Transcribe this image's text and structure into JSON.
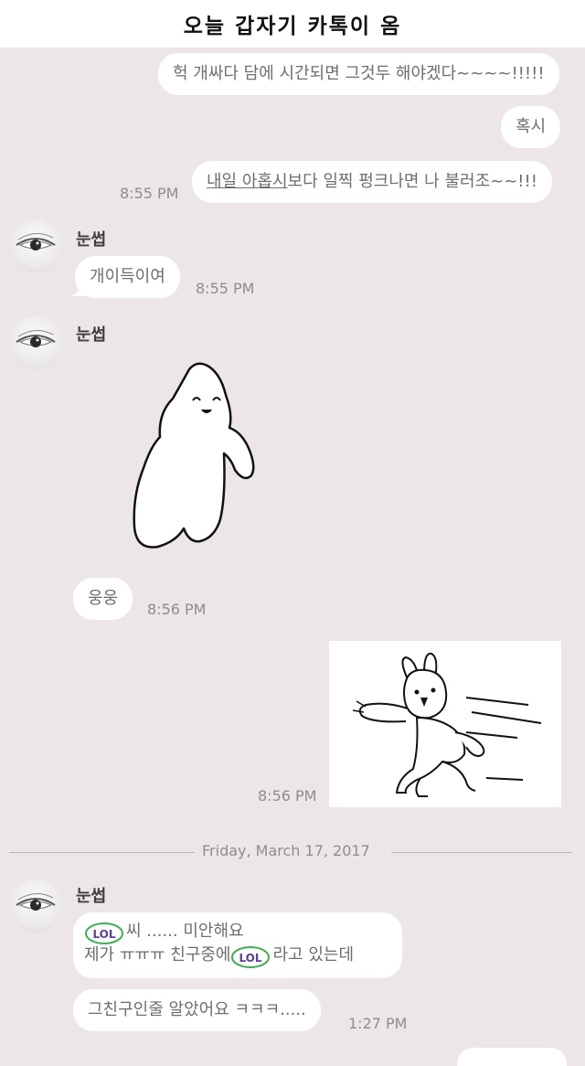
{
  "header": {
    "title": "오늘 갑자기 카톡이 옴"
  },
  "messages": {
    "m1": "헉 개싸다 담에 시간되면 그것두 해야겠다~~~~!!!!!",
    "m2": "혹시",
    "m3_underlined": "내일 아홉시",
    "m3_rest": "보다 일찍 펑크나면 나 불러조~~!!!",
    "m3_time": "8:55 PM",
    "sender1_name": "눈썹",
    "m4": "개이득이여",
    "m4_time": "8:55 PM",
    "sender2_name": "눈썹",
    "m5": "웅웅",
    "m5_time": "8:56 PM",
    "m6_time": "8:56 PM",
    "date_divider": "Friday, March 17, 2017",
    "sender3_name": "눈썹",
    "m7_line1_rest": "씨 ...... 미안해요",
    "m7_line2_a": "제가 ㅠㅠㅠ 친구중에",
    "m7_line2_b": "라고 있는데",
    "m8": "그친구인줄 알았어요 ㅋㅋㅋ.....",
    "m8_time": "1:27 PM",
    "lol_label": "LOL"
  },
  "colors": {
    "background": "#ece6ea",
    "bubble": "#ffffff",
    "lol_purple": "#5b3f9e",
    "lol_green": "#3fae53"
  },
  "icons": [
    "avatar-eye-icon",
    "sticker-waving-ghost",
    "sticker-running-rabbit",
    "lol-badge-icon"
  ]
}
